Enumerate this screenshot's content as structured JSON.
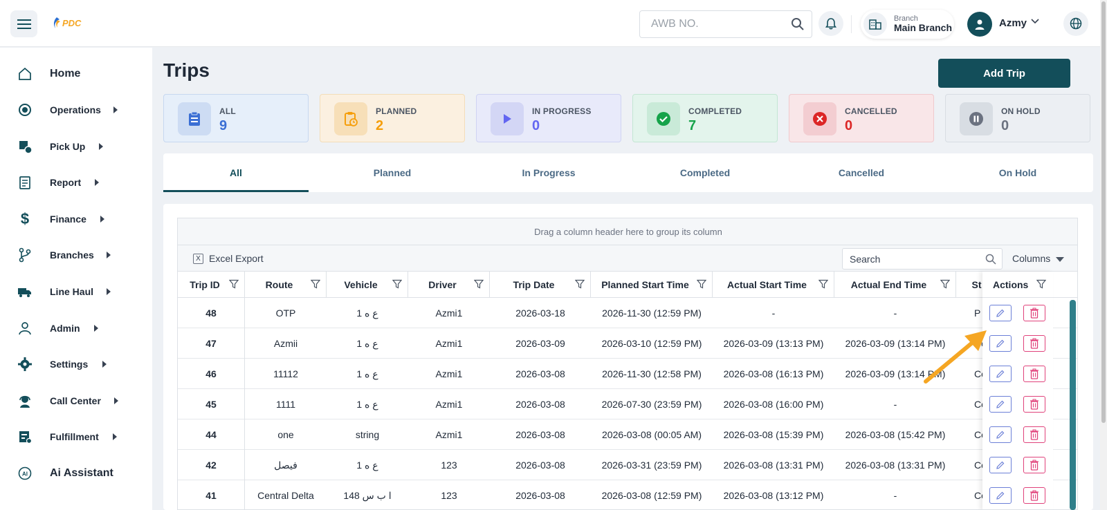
{
  "header": {
    "logo_text": "PDC",
    "search_placeholder": "AWB NO.",
    "branch_label": "Branch",
    "branch_value": "Main Branch",
    "user_name": "Azmy"
  },
  "sidebar": {
    "items": [
      {
        "label": "Home",
        "icon": "home-icon"
      },
      {
        "label": "Operations",
        "icon": "operations-icon"
      },
      {
        "label": "Pick Up",
        "icon": "pickup-icon"
      },
      {
        "label": "Report",
        "icon": "report-icon"
      },
      {
        "label": "Finance",
        "icon": "dollar-icon"
      },
      {
        "label": "Branches",
        "icon": "branches-icon"
      },
      {
        "label": "Line Haul",
        "icon": "truck-icon"
      },
      {
        "label": "Admin",
        "icon": "user-icon"
      },
      {
        "label": "Settings",
        "icon": "gear-icon"
      },
      {
        "label": "Call Center",
        "icon": "headset-icon"
      },
      {
        "label": "Fulfillment",
        "icon": "fulfillment-icon"
      },
      {
        "label": "Ai Assistant",
        "icon": "ai-icon"
      }
    ]
  },
  "page": {
    "title": "Trips",
    "add_button": "Add Trip"
  },
  "cards": [
    {
      "label": "ALL",
      "count": "9",
      "color": "#3b6fd4"
    },
    {
      "label": "PLANNED",
      "count": "2",
      "color": "#f59e0b"
    },
    {
      "label": "IN PROGRESS",
      "count": "0",
      "color": "#6366f1"
    },
    {
      "label": "COMPLETED",
      "count": "7",
      "color": "#16a34a"
    },
    {
      "label": "CANCELLED",
      "count": "0",
      "color": "#dc2626"
    },
    {
      "label": "ON HOLD",
      "count": "0",
      "color": "#6b7280"
    }
  ],
  "tabs": [
    "All",
    "Planned",
    "In Progress",
    "Completed",
    "Cancelled",
    "On Hold"
  ],
  "grid": {
    "group_hint": "Drag a column header here to group its column",
    "excel_export": "Excel Export",
    "excel_icon_text": "X",
    "search_placeholder": "Search",
    "columns_label": "Columns",
    "headers": [
      "Trip ID",
      "Route",
      "Vehicle",
      "Driver",
      "Trip Date",
      "Planned Start Time",
      "Actual Start Time",
      "Actual End Time",
      "St",
      "Actions"
    ],
    "rows": [
      {
        "id": "48",
        "route": "OTP",
        "vehicle": "ع ه 1",
        "driver": "Azmi1",
        "date": "2026-03-18",
        "planned": "2026-11-30 (12:59 PM)",
        "actual_start": "-",
        "actual_end": "-",
        "status": "P"
      },
      {
        "id": "47",
        "route": "Azmii",
        "vehicle": "ع ه 1",
        "driver": "Azmi1",
        "date": "2026-03-09",
        "planned": "2026-03-10 (12:59 PM)",
        "actual_start": "2026-03-09 (13:13 PM)",
        "actual_end": "2026-03-09 (13:14 PM)",
        "status": "Co"
      },
      {
        "id": "46",
        "route": "11112",
        "vehicle": "ع ه 1",
        "driver": "Azmi1",
        "date": "2026-03-08",
        "planned": "2026-11-30 (12:58 PM)",
        "actual_start": "2026-03-08 (16:13 PM)",
        "actual_end": "2026-03-09 (13:14 PM)",
        "status": "Co"
      },
      {
        "id": "45",
        "route": "1111",
        "vehicle": "ع ه 1",
        "driver": "Azmi1",
        "date": "2026-03-08",
        "planned": "2026-07-30 (23:59 PM)",
        "actual_start": "2026-03-08 (16:00 PM)",
        "actual_end": "-",
        "status": "Co"
      },
      {
        "id": "44",
        "route": "one",
        "vehicle": "string",
        "driver": "Azmi1",
        "date": "2026-03-08",
        "planned": "2026-03-08 (00:05 AM)",
        "actual_start": "2026-03-08 (15:39 PM)",
        "actual_end": "2026-03-08 (15:42 PM)",
        "status": "Co"
      },
      {
        "id": "42",
        "route": "فيصل",
        "vehicle": "ع ه 1",
        "driver": "123",
        "date": "2026-03-08",
        "planned": "2026-03-31 (23:59 PM)",
        "actual_start": "2026-03-08 (13:31 PM)",
        "actual_end": "2026-03-08 (13:31 PM)",
        "status": "Co"
      },
      {
        "id": "41",
        "route": "Central Delta",
        "vehicle": "ا ب س 148",
        "driver": "123",
        "date": "2026-03-08",
        "planned": "2026-03-08 (12:59 PM)",
        "actual_start": "2026-03-08 (13:12 PM)",
        "actual_end": "-",
        "status": "Co"
      }
    ]
  },
  "colors": {
    "primary": "#134e5a",
    "annotation_arrow": "#f5a623"
  }
}
